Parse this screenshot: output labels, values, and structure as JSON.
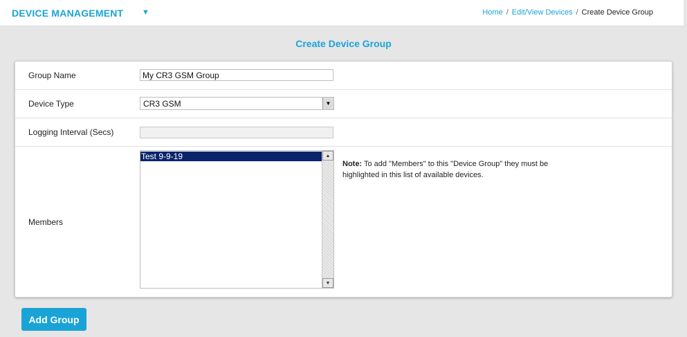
{
  "header": {
    "brand": "DEVICE MANAGEMENT",
    "caret_icon": "caret-down-icon"
  },
  "breadcrumb": {
    "home": "Home",
    "sep": "/",
    "edit_view": "Edit/View Devices",
    "current": "Create Device Group"
  },
  "page": {
    "title": "Create Device Group"
  },
  "form": {
    "group_name": {
      "label": "Group Name",
      "value": "My CR3 GSM Group"
    },
    "device_type": {
      "label": "Device Type",
      "value": "CR3 GSM"
    },
    "logging_interval": {
      "label": "Logging Interval (Secs)",
      "value": ""
    },
    "members": {
      "label": "Members",
      "options": [
        "Test 9-9-19"
      ],
      "note_prefix": "Note:",
      "note_text": "To add \"Members\" to this \"Device Group\" they must be highlighted in this list of available devices."
    }
  },
  "actions": {
    "add_group": "Add Group"
  },
  "colors": {
    "accent": "#1aa3d6",
    "selection": "#0a246a"
  }
}
